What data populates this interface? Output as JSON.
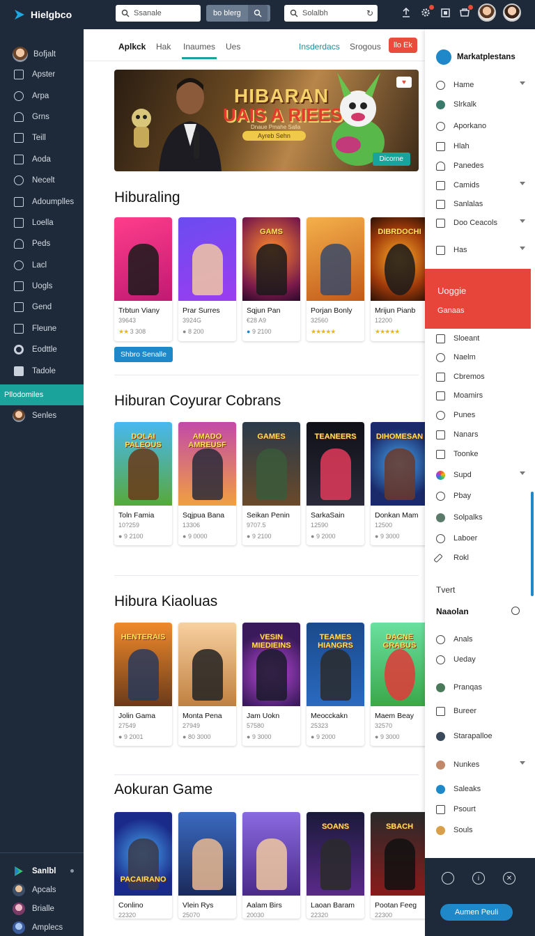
{
  "topbar": {
    "brand": "Hielgbco",
    "search1_placeholder": "Ssanale",
    "tag_button": "bo blerg",
    "search2_placeholder": "Solalbh"
  },
  "sidebar": {
    "user_name": "Bofjalt",
    "items": [
      "Apster",
      "Arpa",
      "Grns",
      "Teill",
      "Aoda",
      "Necelt",
      "Adoumplles",
      "Loella",
      "Peds",
      "Lacl",
      "Uogls",
      "Gend",
      "Fleune",
      "Eodttle",
      "Tadole"
    ],
    "active_item": "Pllodomiles",
    "after_active": "Senles",
    "bottom": [
      "Sanlbl",
      "Apcals",
      "Brialle",
      "Amplecs"
    ]
  },
  "main": {
    "tabs": [
      "Aplkck",
      "Hak",
      "Inaumes",
      "Ues",
      "Insderdacs",
      "Srogous"
    ],
    "tab_button": "llo Ek",
    "banner": {
      "title1": "HIBARAN",
      "title2": "UAIS A RIEES",
      "subtitle": "Dnaue Pmahe Salla",
      "pill": "Ayreb Sehn",
      "cta": "Dicorne"
    },
    "sections": [
      {
        "title": "Hiburaling",
        "games": [
          {
            "name": "Trbtun Viany",
            "num": "39643",
            "meta": "3 308",
            "stars": "★★"
          },
          {
            "name": "Prar Surres",
            "num": "3924G",
            "meta": "8 200"
          },
          {
            "name": "Sqjun Pan",
            "num": "€28 A9",
            "meta": "9 2100"
          },
          {
            "name": "Porjan Bonly",
            "num": "32560",
            "meta": "",
            "stars": "★★★★★"
          },
          {
            "name": "Mrijun Pianb",
            "num": "12200",
            "meta": "",
            "stars": "★★★★★"
          }
        ],
        "art_titles": [
          "",
          "",
          "GAMS",
          "",
          "DIBRDOCHI"
        ],
        "button": "Shbro Senalle"
      },
      {
        "title": "Hiburan Coyurar Cobrans",
        "games": [
          {
            "name": "Toln Famia",
            "num": "10?259",
            "meta": "9 2100"
          },
          {
            "name": "Sqjpua Bana",
            "num": "13306",
            "meta": "9 0000"
          },
          {
            "name": "Seikan Penin",
            "num": "9707.5",
            "meta": "9 2100"
          },
          {
            "name": "SarkaSain",
            "num": "12590",
            "meta": "9 2000"
          },
          {
            "name": "Donkan Mam",
            "num": "12500",
            "meta": "9 3000"
          }
        ],
        "art_titles": [
          "DOLAI PALEOUS",
          "AMADO AMREUSF",
          "GAMES",
          "TEANEERS",
          "DIHOMESAN"
        ]
      },
      {
        "title": "Hibura Kiaoluas",
        "games": [
          {
            "name": "Jolin Gama",
            "num": "27549",
            "meta": "9 2001"
          },
          {
            "name": "Monta Pena",
            "num": "27949",
            "meta": "80 3000"
          },
          {
            "name": "Jam Uokn",
            "num": "57580",
            "meta": "9 3000"
          },
          {
            "name": "Meocckakn",
            "num": "25323",
            "meta": "9 2000"
          },
          {
            "name": "Maem Beay",
            "num": "32570",
            "meta": "9 3000"
          }
        ],
        "art_titles": [
          "HENTERAIS",
          "",
          "VESIN MIEDIEINS",
          "TEAMES HIANGRS",
          "DACNE GRABUS"
        ]
      },
      {
        "title": "Aokuran Game",
        "games": [
          {
            "name": "Conlino",
            "num": "22320",
            "meta": ""
          },
          {
            "name": "Vlein Rys",
            "num": "25070",
            "meta": ""
          },
          {
            "name": "Aalam Birs",
            "num": "20030",
            "meta": ""
          },
          {
            "name": "Laoan Baram",
            "num": "22320",
            "meta": ""
          },
          {
            "name": "Pootan Feeg",
            "num": "22300",
            "meta": ""
          }
        ],
        "art_titles": [
          "PACAIRANO",
          "",
          "",
          "SOANS",
          "SBACH"
        ]
      }
    ]
  },
  "rpanel": {
    "title": "Markatplestans",
    "items_top": [
      "Hame",
      "Slrkalk",
      "Aporkano",
      "Hlah",
      "Panedes",
      "Camids",
      "Sanlalas",
      "Doo Ceacols",
      "Has"
    ],
    "red_title": "Uoggie",
    "red_sub": "Ganaas",
    "items_mid": [
      "Sloeant",
      "Naelm",
      "Cbremos",
      "Moamirs",
      "Punes",
      "Nanars",
      "Toonke",
      "Supd",
      "Pbay",
      "Solpalks",
      "Laboer",
      "Rokl"
    ],
    "label1": "Tvert",
    "label2": "Naaolan",
    "items_bottom": [
      "Anals",
      "Ueday",
      "Pranqas",
      "Bureer",
      "Starapalloe",
      "Nunkes",
      "Saleaks",
      "Psourt",
      "Souls"
    ],
    "footer_button": "Aumen Peuli"
  },
  "colors": {
    "dark": "#1e2a3a",
    "teal": "#1aa39b",
    "red": "#e8453a",
    "blue": "#1e88c8"
  }
}
